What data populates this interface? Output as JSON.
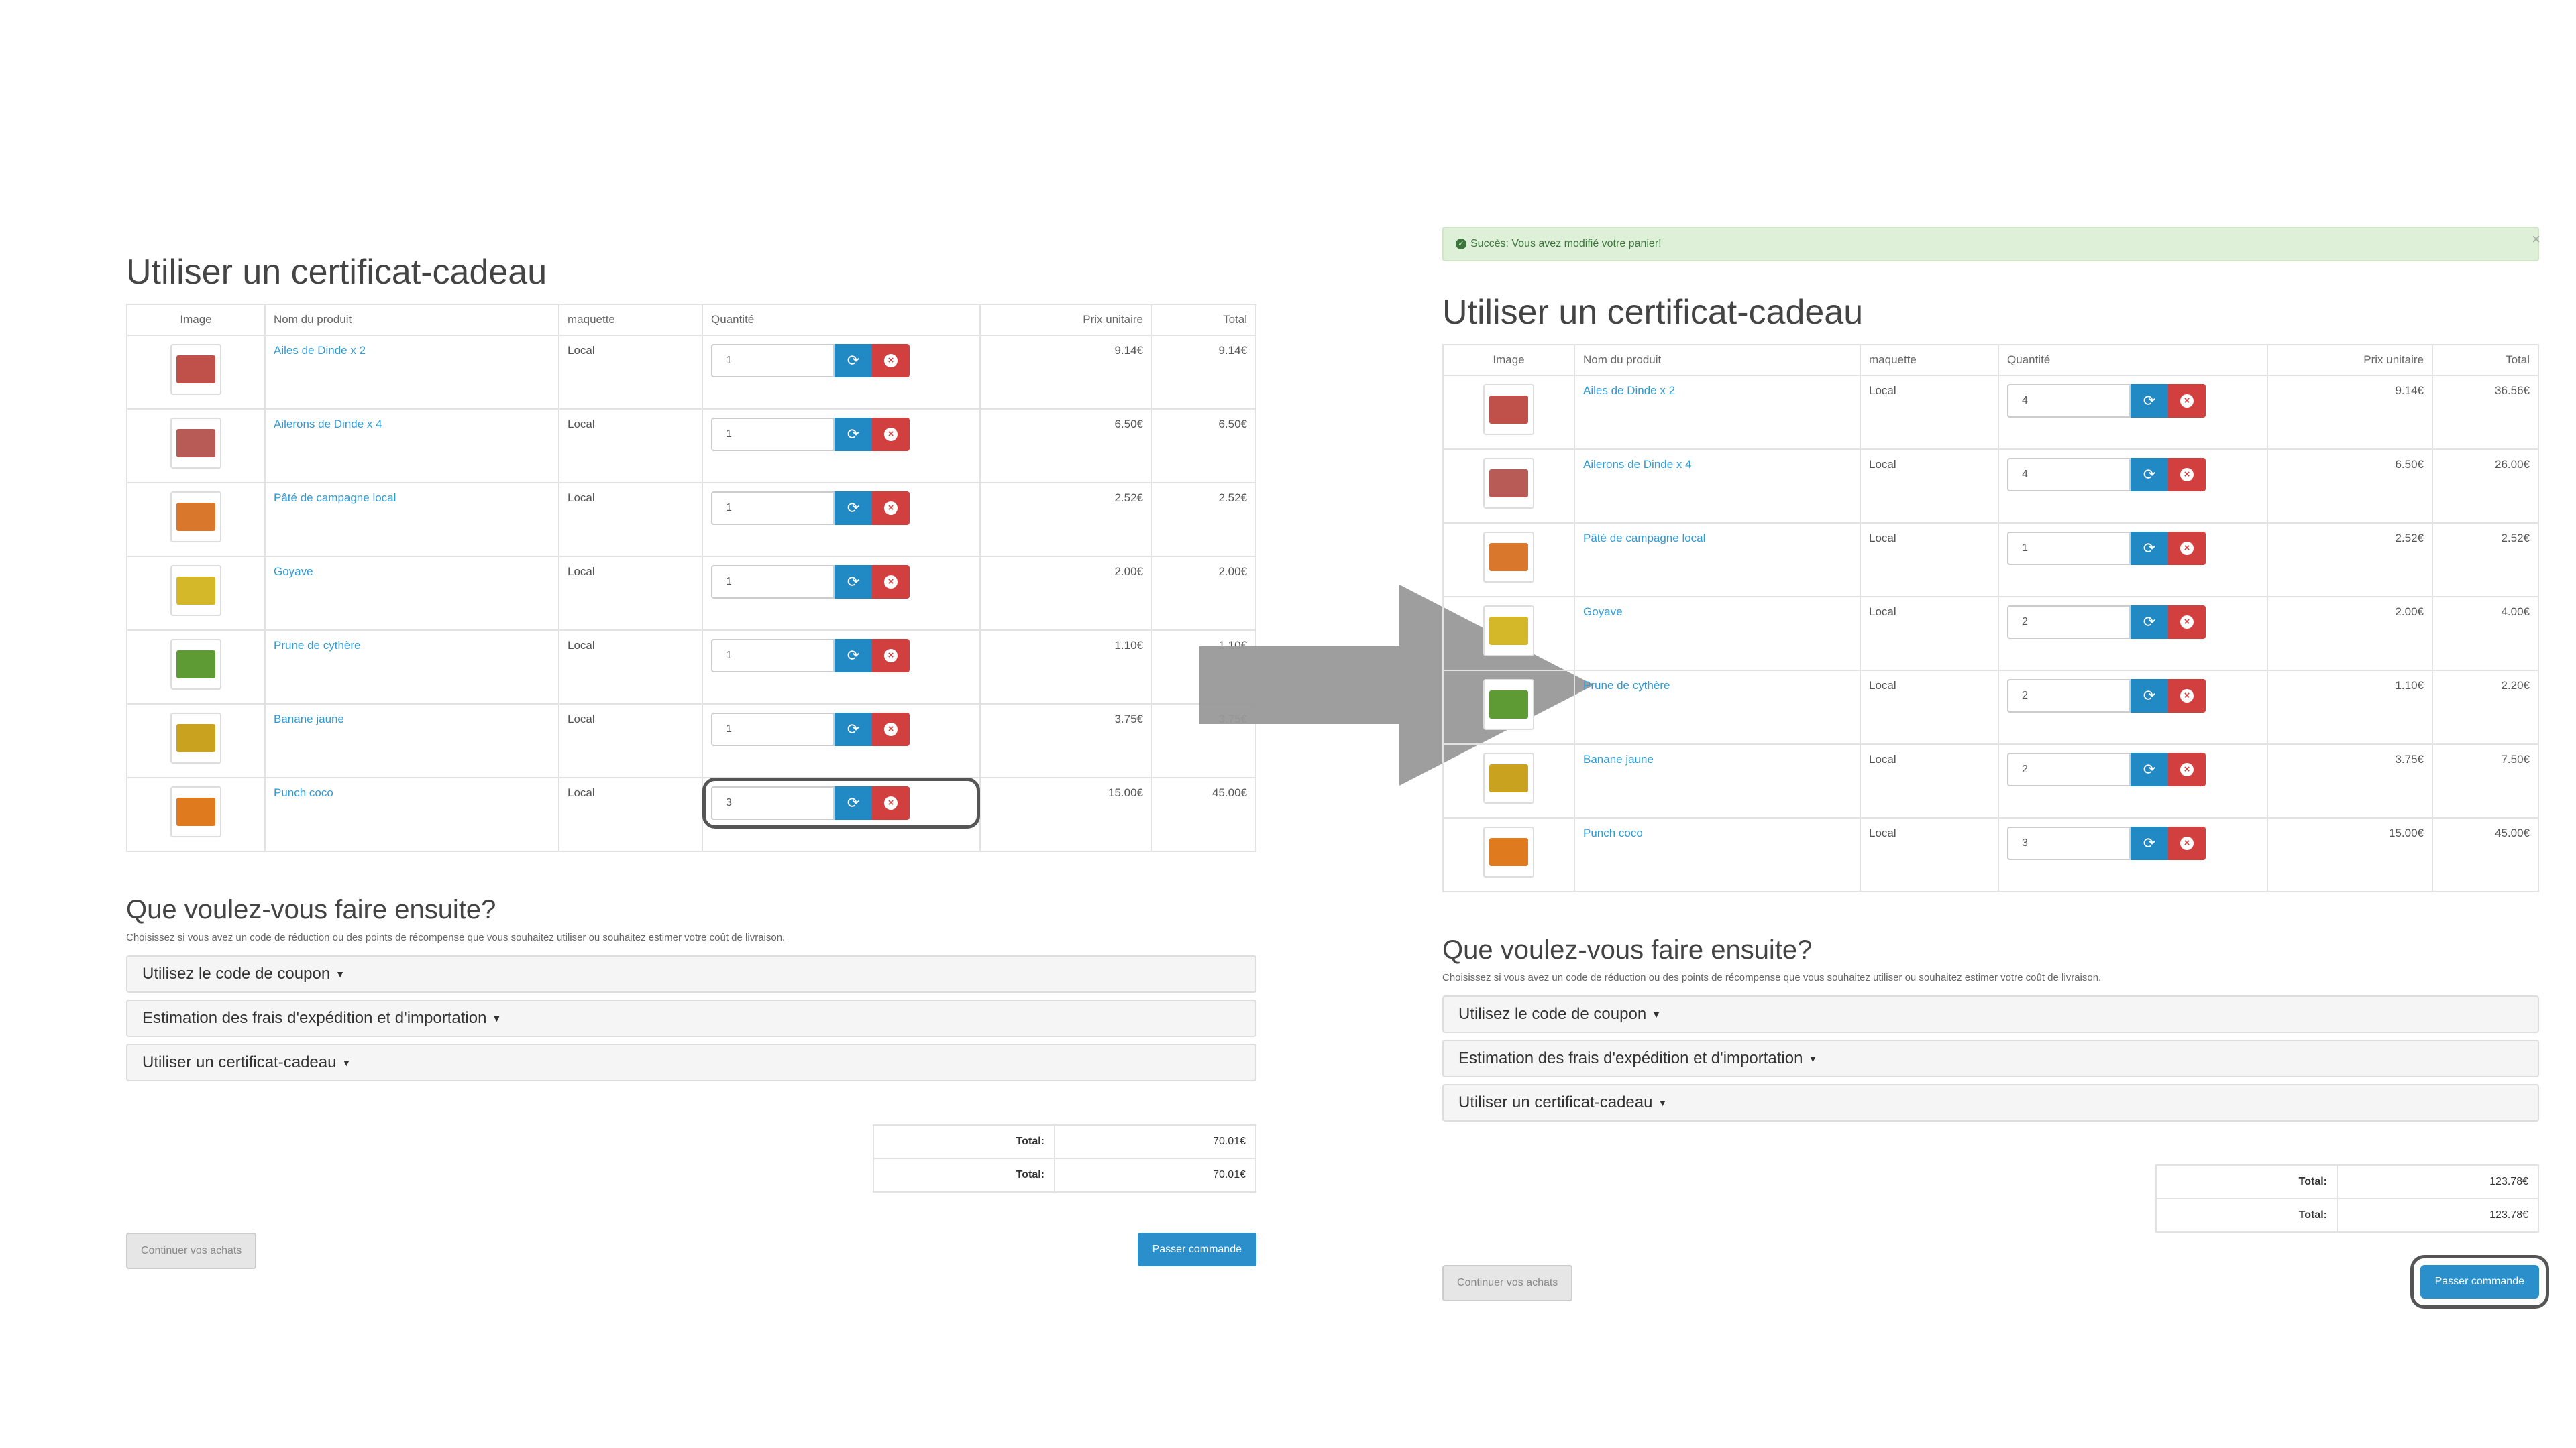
{
  "left": {
    "title": "Utiliser un certificat-cadeau",
    "columns": [
      "Image",
      "Nom du produit",
      "maquette",
      "Quantité",
      "Prix unitaire",
      "Total"
    ],
    "rows": [
      {
        "name": "Ailes de Dinde x 2",
        "model": "Local",
        "qty": "1",
        "unit": "9.14€",
        "total": "9.14€"
      },
      {
        "name": "Ailerons de Dinde x 4",
        "model": "Local",
        "qty": "1",
        "unit": "6.50€",
        "total": "6.50€"
      },
      {
        "name": "Pâté de campagne local",
        "model": "Local",
        "qty": "1",
        "unit": "2.52€",
        "total": "2.52€"
      },
      {
        "name": "Goyave",
        "model": "Local",
        "qty": "1",
        "unit": "2.00€",
        "total": "2.00€"
      },
      {
        "name": "Prune de cythère",
        "model": "Local",
        "qty": "1",
        "unit": "1.10€",
        "total": "1.10€"
      },
      {
        "name": "Banane jaune",
        "model": "Local",
        "qty": "1",
        "unit": "3.75€",
        "total": "3.75€"
      },
      {
        "name": "Punch coco",
        "model": "Local",
        "qty": "3",
        "unit": "15.00€",
        "total": "45.00€"
      }
    ],
    "next_title": "Que voulez-vous faire ensuite?",
    "next_desc": "Choisissez si vous avez un code de réduction ou des points de récompense que vous souhaitez utiliser ou souhaitez estimer votre coût de livraison.",
    "accordions": [
      "Utilisez le code de coupon",
      "Estimation des frais d'expédition et d'importation",
      "Utiliser un certificat-cadeau"
    ],
    "totals": [
      {
        "label": "Total:",
        "value": "70.01€"
      },
      {
        "label": "Total:",
        "value": "70.01€"
      }
    ],
    "continue_label": "Continuer vos achats",
    "checkout_label": "Passer commande"
  },
  "right": {
    "alert": "Succès: Vous avez modifié votre panier!",
    "alert_close": "×",
    "title": "Utiliser un certificat-cadeau",
    "columns": [
      "Image",
      "Nom du produit",
      "maquette",
      "Quantité",
      "Prix unitaire",
      "Total"
    ],
    "rows": [
      {
        "name": "Ailes de Dinde x 2",
        "model": "Local",
        "qty": "4",
        "unit": "9.14€",
        "total": "36.56€"
      },
      {
        "name": "Ailerons de Dinde x 4",
        "model": "Local",
        "qty": "4",
        "unit": "6.50€",
        "total": "26.00€"
      },
      {
        "name": "Pâté de campagne local",
        "model": "Local",
        "qty": "1",
        "unit": "2.52€",
        "total": "2.52€"
      },
      {
        "name": "Goyave",
        "model": "Local",
        "qty": "2",
        "unit": "2.00€",
        "total": "4.00€"
      },
      {
        "name": "Prune de cythère",
        "model": "Local",
        "qty": "2",
        "unit": "1.10€",
        "total": "2.20€"
      },
      {
        "name": "Banane jaune",
        "model": "Local",
        "qty": "2",
        "unit": "3.75€",
        "total": "7.50€"
      },
      {
        "name": "Punch coco",
        "model": "Local",
        "qty": "3",
        "unit": "15.00€",
        "total": "45.00€"
      }
    ],
    "next_title": "Que voulez-vous faire ensuite?",
    "next_desc": "Choisissez si vous avez un code de réduction ou des points de récompense que vous souhaitez utiliser ou souhaitez estimer votre coût de livraison.",
    "accordions": [
      "Utilisez le code de coupon",
      "Estimation des frais d'expédition et d'importation",
      "Utiliser un certificat-cadeau"
    ],
    "totals": [
      {
        "label": "Total:",
        "value": "123.78€"
      },
      {
        "label": "Total:",
        "value": "123.78€"
      }
    ],
    "continue_label": "Continuer vos achats",
    "checkout_label": "Passer commande"
  },
  "icons": {
    "refresh": "refresh-icon",
    "remove": "remove-icon",
    "caret": "caret-down-icon",
    "arrow": "right-arrow-icon",
    "success": "check-circle-icon"
  },
  "colors": {
    "link": "#2f9bd6",
    "refresh_btn": "#2189c4",
    "remove_btn": "#d23f3f",
    "checkout_btn": "#2a8fca",
    "alert_bg": "#dff0d8",
    "arrow": "#999999"
  }
}
